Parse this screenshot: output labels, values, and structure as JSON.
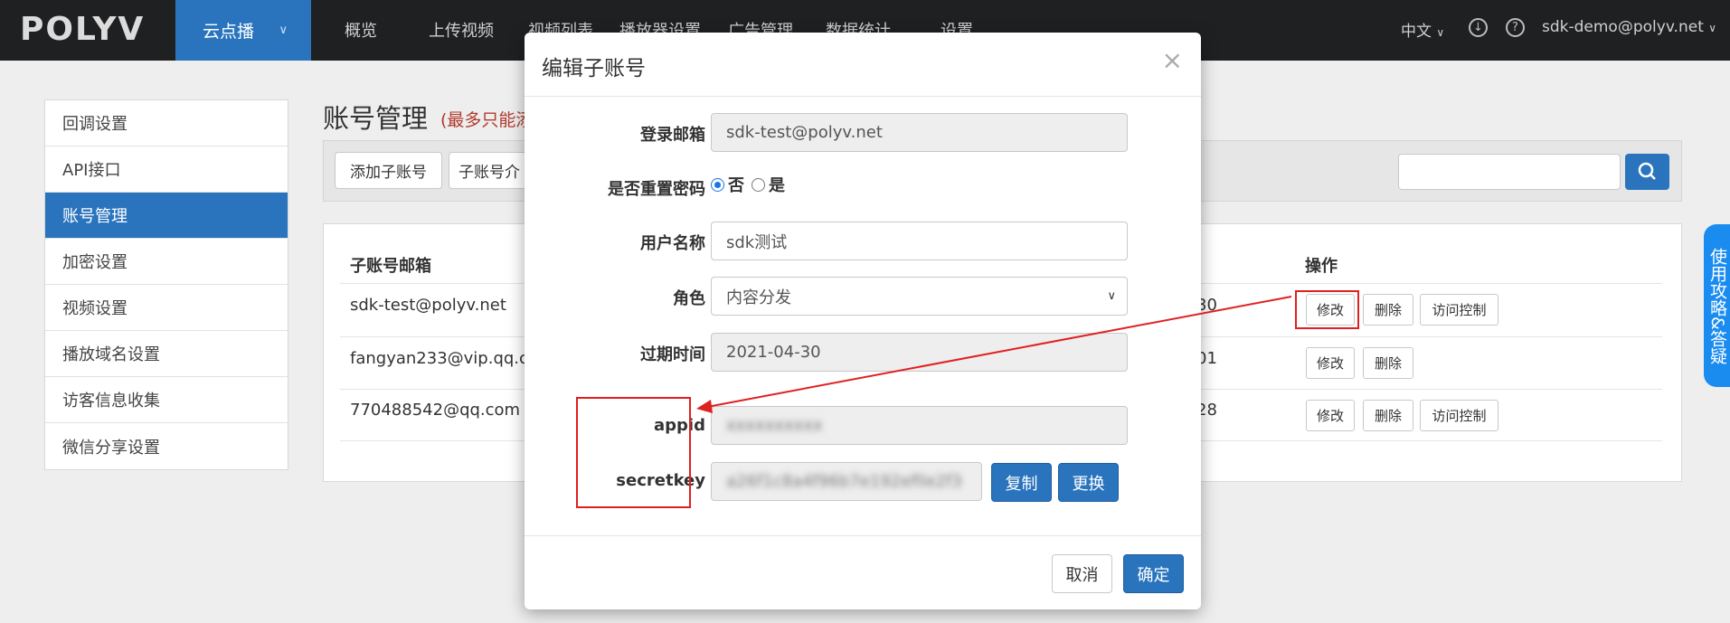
{
  "nav": {
    "logo": "POLYV",
    "product": "云点播",
    "items": [
      "概览",
      "上传视频",
      "视频列表",
      "播放器设置",
      "广告管理",
      "数据统计",
      "设置"
    ],
    "lang": "中文",
    "user": "sdk-demo@polyv.net",
    "download_icon": "download-icon",
    "help_icon": "question-icon"
  },
  "sidebar": {
    "items": [
      {
        "label": "回调设置"
      },
      {
        "label": "API接口"
      },
      {
        "label": "账号管理"
      },
      {
        "label": "加密设置"
      },
      {
        "label": "视频设置"
      },
      {
        "label": "播放域名设置"
      },
      {
        "label": "访客信息收集"
      },
      {
        "label": "微信分享设置"
      }
    ],
    "active": "账号管理"
  },
  "main": {
    "title": "账号管理",
    "note": "(最多只能添",
    "add_button": "添加子账号",
    "intro_button": "子账号介",
    "table": {
      "headers": {
        "email": "子账号邮箱",
        "actions": "操作"
      },
      "rows": [
        {
          "email": "sdk-test@polyv.net",
          "date_tail": "30",
          "edit": "修改",
          "delete": "删除",
          "access": "访问控制"
        },
        {
          "email": "fangyan233@vip.qq.com",
          "date_tail": "01",
          "edit": "修改",
          "delete": "删除"
        },
        {
          "email": "770488542@qq.com",
          "date_tail": "28",
          "edit": "修改",
          "delete": "删除",
          "access": "访问控制"
        }
      ]
    }
  },
  "help_tab": "使用攻略&答疑",
  "modal": {
    "title": "编辑子账号",
    "close": "×",
    "fields": {
      "email_label": "登录邮箱",
      "email_value": "sdk-test@polyv.net",
      "reset_label": "是否重置密码",
      "reset_no": "否",
      "reset_yes": "是",
      "name_label": "用户名称",
      "name_value": "sdk测试",
      "role_label": "角色",
      "role_value": "内容分发",
      "expire_label": "过期时间",
      "expire_value": "2021-04-30",
      "appid_label": "appid",
      "appid_value": "xxxxxxxxxx",
      "secret_label": "secretkey",
      "secret_value": "a26f1c8a4f96b7e192efile2f3"
    },
    "copy_button": "复制",
    "replace_button": "更换",
    "cancel_button": "取消",
    "confirm_button": "确定"
  },
  "annotation_color": "#e02020",
  "accent_color": "#2a74be"
}
